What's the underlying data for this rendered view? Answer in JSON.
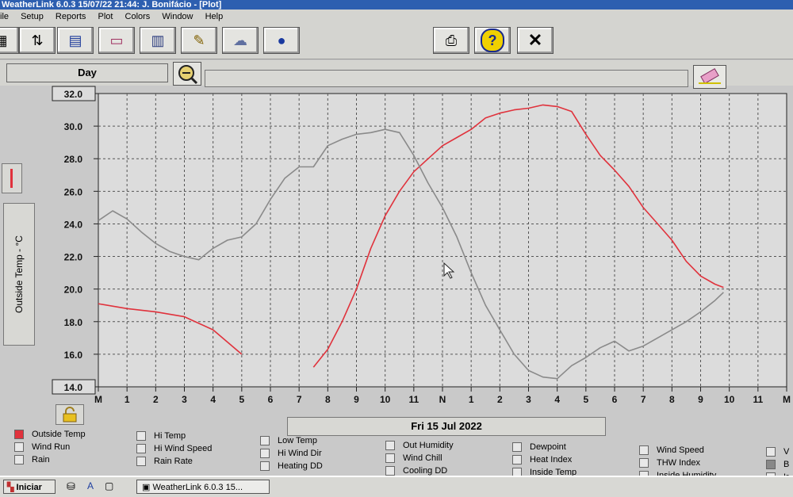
{
  "window": {
    "title": "WeatherLink 6.0.3  15/07/22  21:44: J. Bonifácio - [Plot]"
  },
  "menu": [
    "ile",
    "Setup",
    "Reports",
    "Plot",
    "Colors",
    "Window",
    "Help"
  ],
  "toolbar": {
    "left_icons": [
      "bulletin-icon",
      "download-icon",
      "summary-icon",
      "strip-chart-icon",
      "plot-icon",
      "notepad-icon",
      "weather-icon",
      "noaa-icon"
    ],
    "right_icons": [
      "print-icon",
      "help-icon",
      "close-icon"
    ]
  },
  "range": {
    "period": "Day",
    "range_field": ""
  },
  "chart_data": {
    "type": "line",
    "ylabel": "Outside Temp - °C",
    "xlabel": "Fri 15 Jul 2022",
    "ylim": [
      14.0,
      32.0
    ],
    "y_ticks": [
      "32.0",
      "30.0",
      "28.0",
      "26.0",
      "24.0",
      "22.0",
      "20.0",
      "18.0",
      "16.0",
      "14.0"
    ],
    "x_ticks": [
      "M",
      "1",
      "2",
      "3",
      "4",
      "5",
      "6",
      "7",
      "8",
      "9",
      "10",
      "11",
      "N",
      "1",
      "2",
      "3",
      "4",
      "5",
      "6",
      "7",
      "8",
      "9",
      "10",
      "11",
      "M"
    ],
    "series": [
      {
        "name": "Outside Temp",
        "color": "#e0323c",
        "segments": [
          {
            "x": [
              0.0,
              1.0,
              2.0,
              3.0,
              4.0,
              5.0
            ],
            "y": [
              19.1,
              18.8,
              18.6,
              18.3,
              17.5,
              16.0
            ]
          },
          {
            "x": [
              7.5,
              8.0,
              8.5,
              9.0,
              9.5,
              10.0,
              10.5,
              11.0,
              11.5,
              12.0,
              12.5,
              13.0,
              13.5,
              14.0,
              14.5,
              15.0,
              15.5,
              16.0,
              16.5,
              17.0,
              17.5,
              18.0,
              18.5,
              19.0,
              19.5,
              20.0,
              20.5,
              21.0,
              21.5,
              21.8
            ],
            "y": [
              15.2,
              16.3,
              18.0,
              20.0,
              22.5,
              24.5,
              26.0,
              27.2,
              28.0,
              28.8,
              29.3,
              29.8,
              30.5,
              30.8,
              31.0,
              31.1,
              31.3,
              31.2,
              30.9,
              29.5,
              28.2,
              27.3,
              26.3,
              25.0,
              24.0,
              23.0,
              21.7,
              20.8,
              20.3,
              20.1
            ]
          }
        ]
      },
      {
        "name": "",
        "color": "#8a8a8a",
        "segments": [
          {
            "x": [
              0.0,
              0.5,
              1.0,
              1.5,
              2.0,
              2.5,
              3.0,
              3.5,
              4.0,
              4.5,
              5.0,
              5.5,
              6.0,
              6.5,
              7.0,
              7.5,
              8.0,
              8.5,
              9.0,
              9.5,
              10.0,
              10.5,
              11.0,
              11.5,
              12.0,
              12.5,
              13.0,
              13.5,
              14.0,
              14.5,
              15.0,
              15.5,
              16.0,
              16.5,
              17.0,
              17.5,
              18.0,
              18.5,
              19.0,
              19.5,
              20.0,
              20.5,
              21.0,
              21.5,
              21.8
            ],
            "y": [
              24.2,
              24.8,
              24.3,
              23.5,
              22.8,
              22.3,
              22.0,
              21.8,
              22.5,
              23.0,
              23.2,
              24.0,
              25.5,
              26.8,
              27.5,
              27.5,
              28.8,
              29.2,
              29.5,
              29.6,
              29.8,
              29.6,
              28.2,
              26.5,
              25.0,
              23.2,
              21.0,
              19.0,
              17.5,
              16.0,
              15.0,
              14.6,
              14.5,
              15.3,
              15.8,
              16.4,
              16.8,
              16.2,
              16.5,
              17.0,
              17.5,
              18.0,
              18.6,
              19.3,
              19.8
            ]
          }
        ]
      }
    ],
    "legend": [
      {
        "label": "Outside Temp",
        "checked": true,
        "color": "#e0323c"
      },
      {
        "label": "Wind Run",
        "checked": false
      },
      {
        "label": "Rain",
        "checked": false
      },
      {
        "label": "Hi Temp",
        "checked": false
      },
      {
        "label": "Hi Wind Speed",
        "checked": false
      },
      {
        "label": "Rain Rate",
        "checked": false
      },
      {
        "label": "Low Temp",
        "checked": false
      },
      {
        "label": "Hi Wind Dir",
        "checked": false
      },
      {
        "label": "Heating DD",
        "checked": false
      },
      {
        "label": "Out Humidity",
        "checked": false
      },
      {
        "label": "Wind Chill",
        "checked": false
      },
      {
        "label": "Cooling DD",
        "checked": false
      },
      {
        "label": "Dewpoint",
        "checked": false
      },
      {
        "label": "Heat Index",
        "checked": false
      },
      {
        "label": "Inside Temp",
        "checked": false
      },
      {
        "label": "Wind Speed",
        "checked": false
      },
      {
        "label": "THW Index",
        "checked": false
      },
      {
        "label": "Inside Humidity",
        "checked": false
      },
      {
        "label": "V",
        "checked": false
      },
      {
        "label": "B",
        "checked": true
      },
      {
        "label": "Ir",
        "checked": false
      }
    ]
  },
  "taskbar": {
    "start": "Iniciar",
    "item": "WeatherLink 6.0.3  15..."
  }
}
